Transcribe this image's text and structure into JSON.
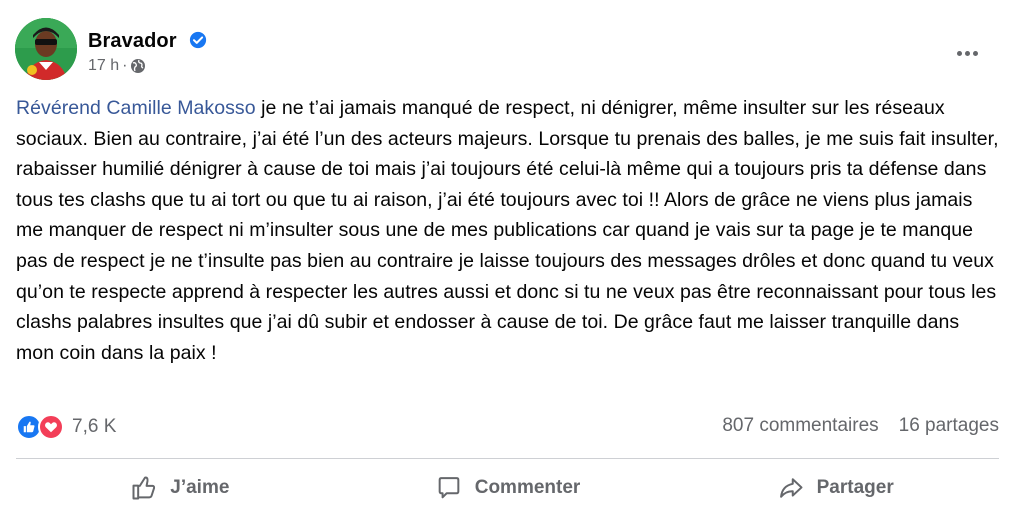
{
  "post": {
    "author": "Bravador",
    "time": "17 h",
    "time_separator": "·",
    "mention": "Révérend  Camille Makosso",
    "text": " je ne t’ai jamais manqué de respect, ni dénigrer, même insulter sur les réseaux sociaux. Bien au contraire, j’ai été l’un des acteurs majeurs. Lorsque tu prenais des balles, je me suis fait insulter, rabaisser humilié dénigrer à cause de toi mais j’ai toujours été celui-là même qui a toujours pris ta défense dans tous tes clashs que tu ai tort ou que tu ai raison, j’ai été toujours avec toi !! Alors de grâce ne viens plus jamais me manquer de respect ni m’insulter sous une de mes publications car quand je vais sur ta page je te manque pas de respect je ne t’insulte pas bien au contraire je laisse toujours des messages drôles et donc quand tu veux qu’on te respecte apprend à respecter les autres aussi et donc si tu ne veux pas être reconnaissant pour tous les clashs  palabres insultes que j’ai dû subir et endosser à cause de toi. De grâce faut me laisser tranquille dans mon coin dans la paix !"
  },
  "stats": {
    "reactions": "7,6 K",
    "comments": "807 commentaires",
    "shares": "16 partages"
  },
  "actions": {
    "like": "J’aime",
    "comment": "Commenter",
    "share": "Partager"
  },
  "colors": {
    "mention": "#385898",
    "secondary_text": "#65676b",
    "like_blue": "#1877f2",
    "love_red": "#f33e58"
  },
  "icons": [
    "verified-badge-icon",
    "globe-icon",
    "more-options-icon",
    "like-reaction-icon",
    "love-reaction-icon",
    "thumbs-up-icon",
    "comment-icon",
    "share-icon"
  ]
}
